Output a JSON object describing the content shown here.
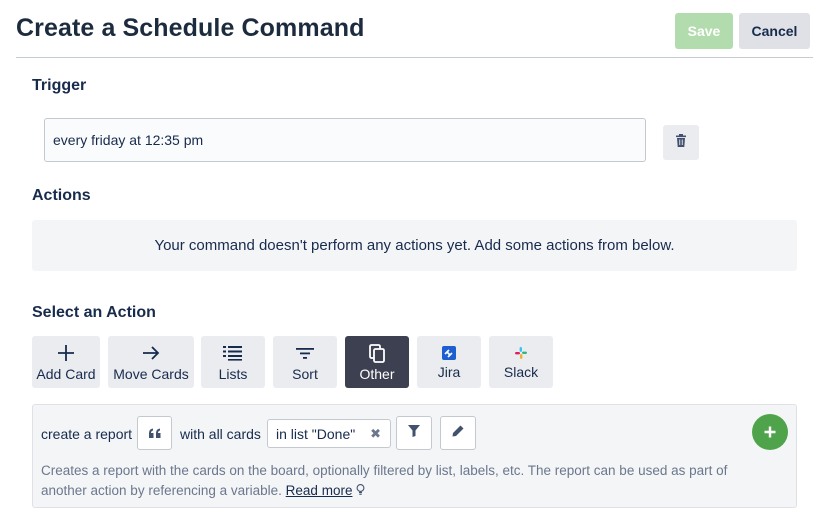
{
  "header": {
    "title": "Create a Schedule Command",
    "save_label": "Save",
    "cancel_label": "Cancel"
  },
  "trigger": {
    "label": "Trigger",
    "value": "every friday at 12:35 pm"
  },
  "actions": {
    "label": "Actions",
    "empty_message": "Your command doesn't perform any actions yet. Add some actions from below."
  },
  "select_action": {
    "label": "Select an Action",
    "tiles": [
      {
        "label": "Add Card",
        "icon": "plus-icon"
      },
      {
        "label": "Move Cards",
        "icon": "arrow-right-icon"
      },
      {
        "label": "Lists",
        "icon": "list-icon"
      },
      {
        "label": "Sort",
        "icon": "sort-icon"
      },
      {
        "label": "Other",
        "icon": "copy-icon",
        "active": true
      },
      {
        "label": "Jira",
        "icon": "jira-icon"
      },
      {
        "label": "Slack",
        "icon": "slack-icon"
      }
    ]
  },
  "action_panel": {
    "prefix": "create a report",
    "middle": "with all cards",
    "list_filter": "in list \"Done\"",
    "description": "Creates a report with the cards on the board, optionally filtered by list, labels, etc. The report can be used as part of another action by referencing a variable.",
    "read_more": "Read more"
  },
  "colors": {
    "save_disabled": "#b3dcae",
    "active_tile": "#3d4050",
    "add_green": "#4fa44b"
  }
}
